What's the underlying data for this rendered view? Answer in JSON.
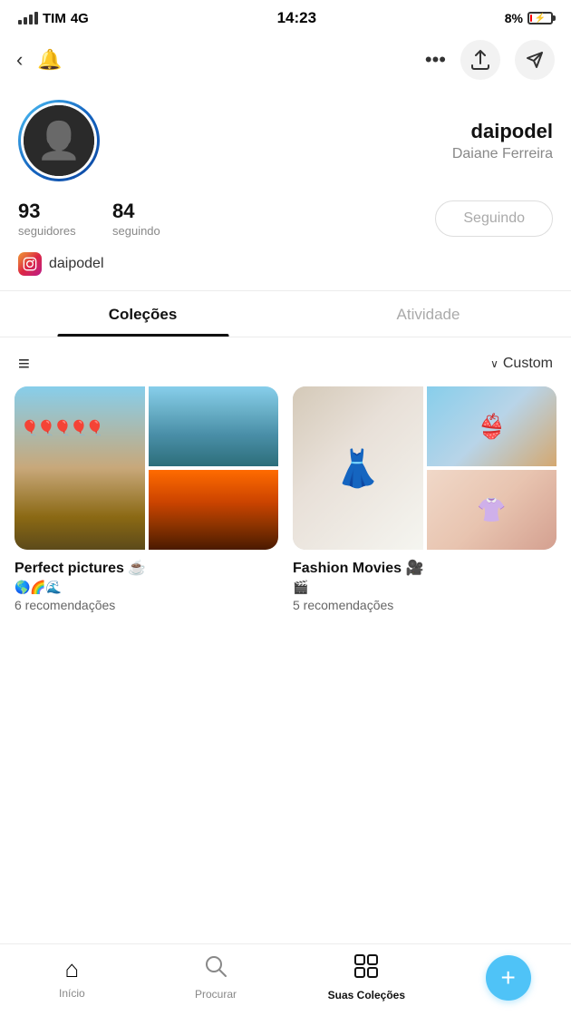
{
  "statusBar": {
    "carrier": "TIM",
    "network": "4G",
    "time": "14:23",
    "battery": "8%"
  },
  "topNav": {
    "backIcon": "‹",
    "bellIcon": "🔔",
    "moreIcon": "•••",
    "shareIcon": "↑",
    "sendIcon": "✈"
  },
  "profile": {
    "username": "daipodel",
    "fullname": "Daiane Ferreira",
    "followers": "93",
    "followersLabel": "seguidores",
    "following": "84",
    "followingLabel": "seguindo",
    "followButton": "Seguindo",
    "instagramHandle": "daipodel"
  },
  "tabs": [
    {
      "label": "Coleções",
      "active": true
    },
    {
      "label": "Atividade",
      "active": false
    }
  ],
  "toolbar": {
    "sortLabel": "Custom"
  },
  "collections": [
    {
      "title": "Perfect pictures ☕",
      "subtitle": "🌎🌈🌊",
      "subsuffix": "6 recomendações"
    },
    {
      "title": "Fashion Movies 🎥",
      "subtitle": "🎬",
      "subsuffix": "5 recomendações"
    }
  ],
  "bottomNav": [
    {
      "icon": "⌂",
      "label": "Início",
      "active": false
    },
    {
      "icon": "🔍",
      "label": "Procurar",
      "active": false
    },
    {
      "icon": "⊞",
      "label": "Suas Coleções",
      "active": true
    }
  ],
  "fab": "+"
}
